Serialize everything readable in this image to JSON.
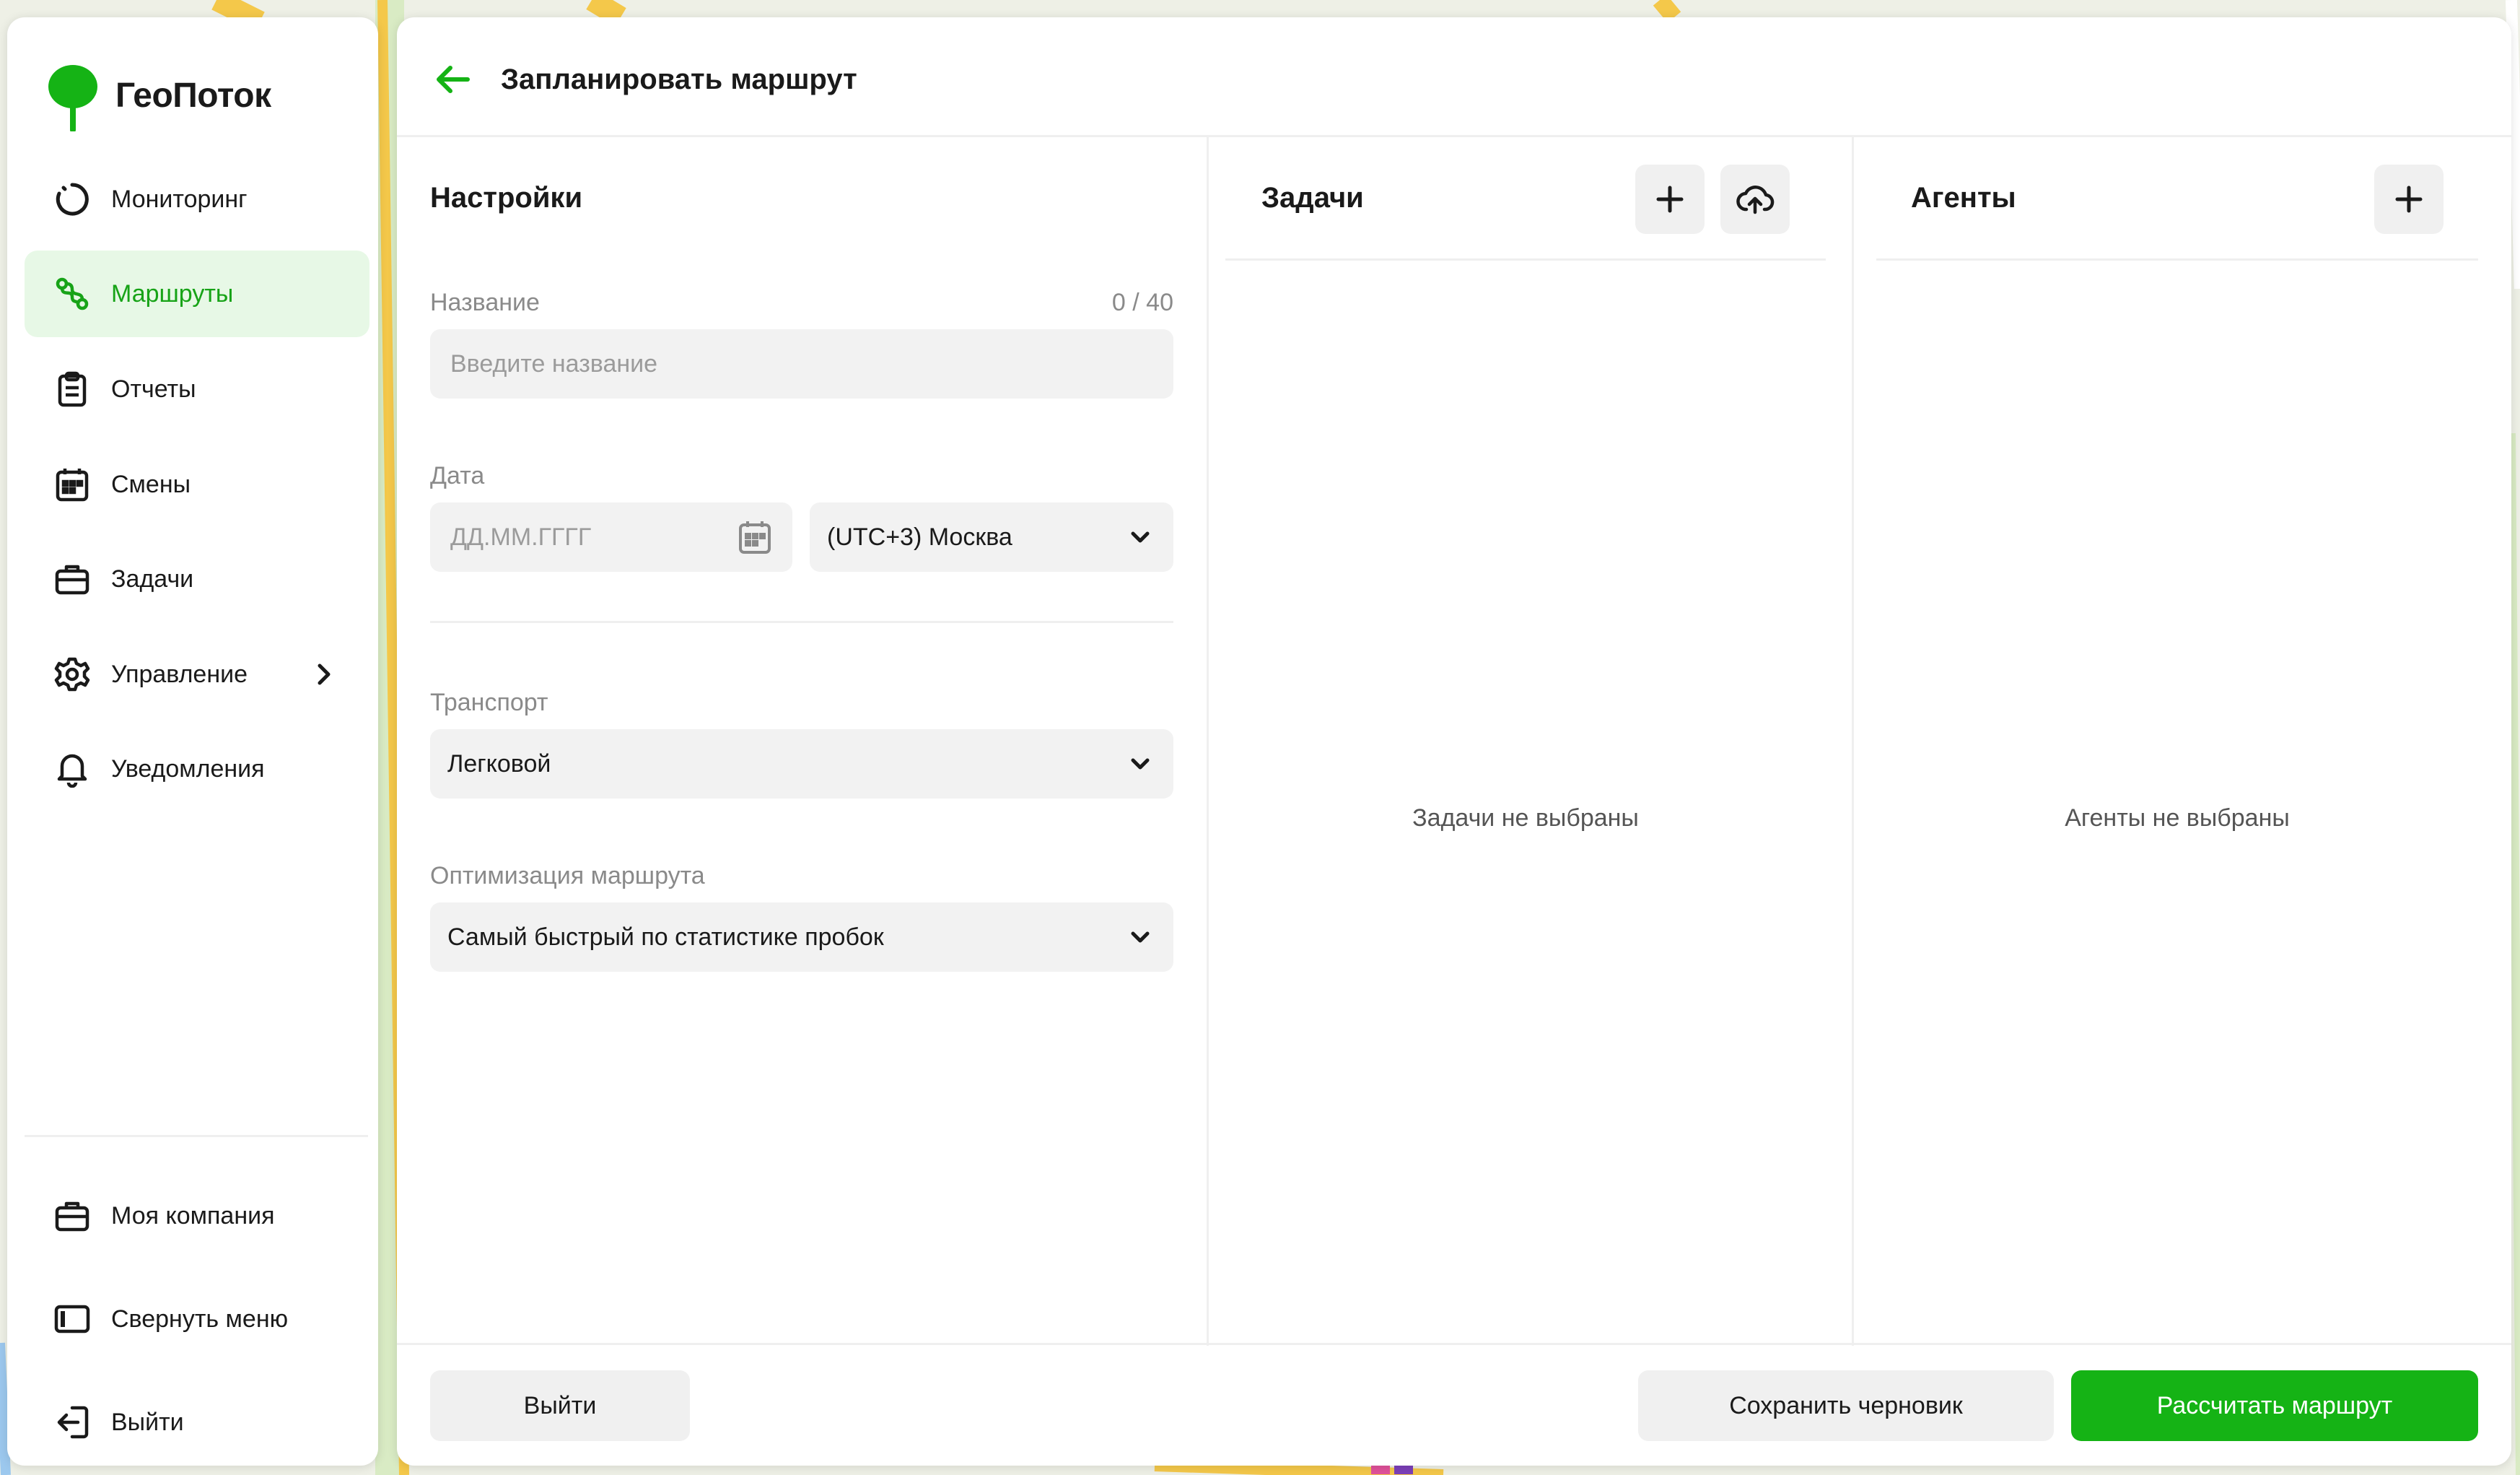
{
  "app": {
    "name": "ГеоПоток"
  },
  "colors": {
    "accent": "#15b315",
    "active_bg": "#e7f8e6",
    "accent_text": "#17a317"
  },
  "sidebar": {
    "items": [
      {
        "label": "Мониторинг",
        "icon": "loader-circle-icon"
      },
      {
        "label": "Маршруты",
        "icon": "route-icon",
        "active": true
      },
      {
        "label": "Отчеты",
        "icon": "clipboard-icon"
      },
      {
        "label": "Смены",
        "icon": "calendar-icon"
      },
      {
        "label": "Задачи",
        "icon": "briefcase-icon"
      },
      {
        "label": "Управление",
        "icon": "gear-icon",
        "has_submenu": true
      },
      {
        "label": "Уведомления",
        "icon": "bell-icon"
      }
    ],
    "bottom_items": [
      {
        "label": "Моя компания",
        "icon": "briefcase-icon"
      },
      {
        "label": "Свернуть меню",
        "icon": "sidebar-collapse-icon"
      },
      {
        "label": "Выйти",
        "icon": "logout-icon"
      }
    ]
  },
  "header": {
    "title": "Запланировать маршрут",
    "back_icon": "arrow-left-icon"
  },
  "settings": {
    "title": "Настройки",
    "name": {
      "label": "Название",
      "placeholder": "Введите название",
      "value": "",
      "counter": "0 / 40"
    },
    "date": {
      "label": "Дата",
      "placeholder": "ДД.ММ.ГГГГ",
      "value": "",
      "timezone": "(UTC+3) Москва"
    },
    "transport": {
      "label": "Транспорт",
      "value": "Легковой"
    },
    "optimization": {
      "label": "Оптимизация маршрута",
      "value": "Самый быстрый по статистике пробок"
    }
  },
  "tasks": {
    "title": "Задачи",
    "empty": "Задачи не выбраны"
  },
  "agents": {
    "title": "Агенты",
    "empty": "Агенты не выбраны"
  },
  "footer": {
    "exit_label": "Выйти",
    "draft_label": "Сохранить черновик",
    "calculate_label": "Рассчитать маршрут"
  }
}
